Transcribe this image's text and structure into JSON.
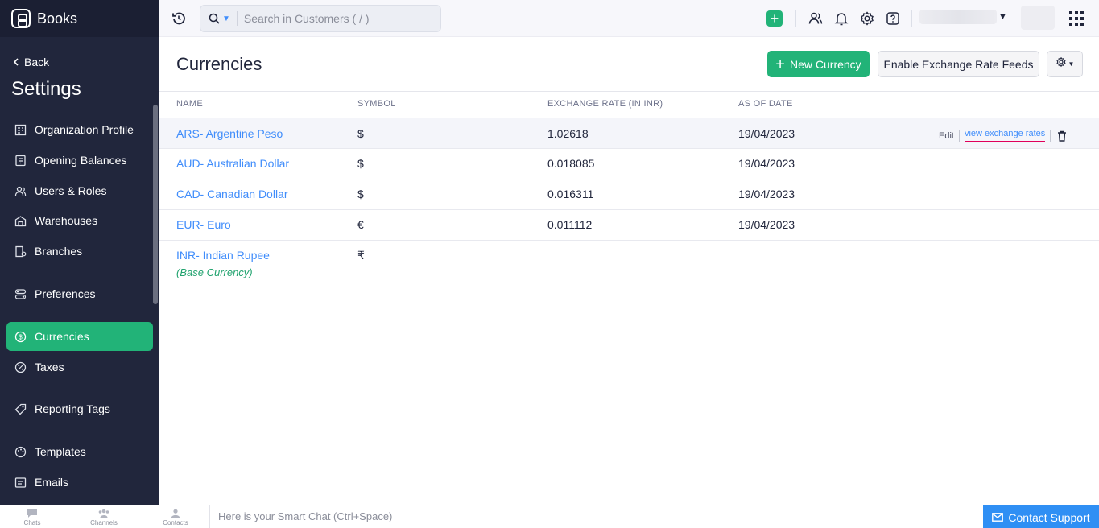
{
  "app": {
    "name": "Books"
  },
  "sidebar": {
    "back_label": "Back",
    "title": "Settings",
    "items": [
      {
        "label": "Organization Profile",
        "icon": "organization-icon"
      },
      {
        "label": "Opening Balances",
        "icon": "opening-balances-icon"
      },
      {
        "label": "Users & Roles",
        "icon": "users-icon"
      },
      {
        "label": "Warehouses",
        "icon": "warehouse-icon"
      },
      {
        "label": "Branches",
        "icon": "branches-icon"
      },
      {
        "label": "Preferences",
        "icon": "preferences-icon"
      },
      {
        "label": "Currencies",
        "icon": "currency-icon",
        "active": true
      },
      {
        "label": "Taxes",
        "icon": "taxes-icon"
      },
      {
        "label": "Reporting Tags",
        "icon": "tag-icon"
      },
      {
        "label": "Templates",
        "icon": "templates-icon"
      },
      {
        "label": "Emails",
        "icon": "email-icon"
      }
    ]
  },
  "header": {
    "search_placeholder": "Search in Customers ( / )"
  },
  "page": {
    "title": "Currencies",
    "new_button": "New Currency",
    "feeds_button": "Enable Exchange Rate Feeds"
  },
  "table": {
    "columns": [
      "NAME",
      "SYMBOL",
      "EXCHANGE RATE (IN INR)",
      "AS OF DATE"
    ],
    "rows": [
      {
        "name": "ARS- Argentine Peso",
        "symbol": "$",
        "rate": "1.02618",
        "date": "19/04/2023"
      },
      {
        "name": "AUD- Australian Dollar",
        "symbol": "$",
        "rate": "0.018085",
        "date": "19/04/2023"
      },
      {
        "name": "CAD- Canadian Dollar",
        "symbol": "$",
        "rate": "0.016311",
        "date": "19/04/2023"
      },
      {
        "name": "EUR- Euro",
        "symbol": "€",
        "rate": "0.011112",
        "date": "19/04/2023"
      },
      {
        "name": "INR- Indian Rupee",
        "symbol": "₹",
        "rate": "",
        "date": "",
        "note": "(Base Currency)"
      }
    ],
    "row_actions": {
      "edit": "Edit",
      "view_rates": "view exchange rates"
    }
  },
  "bottombar": {
    "items": [
      "Chats",
      "Channels",
      "Contacts"
    ],
    "smart_chat_placeholder": "Here is your Smart Chat (Ctrl+Space)",
    "contact_support": "Contact Support"
  },
  "colors": {
    "accent": "#22b378",
    "sidebar": "#21263c",
    "link": "#408dfb",
    "highlight": "#e0005a"
  }
}
